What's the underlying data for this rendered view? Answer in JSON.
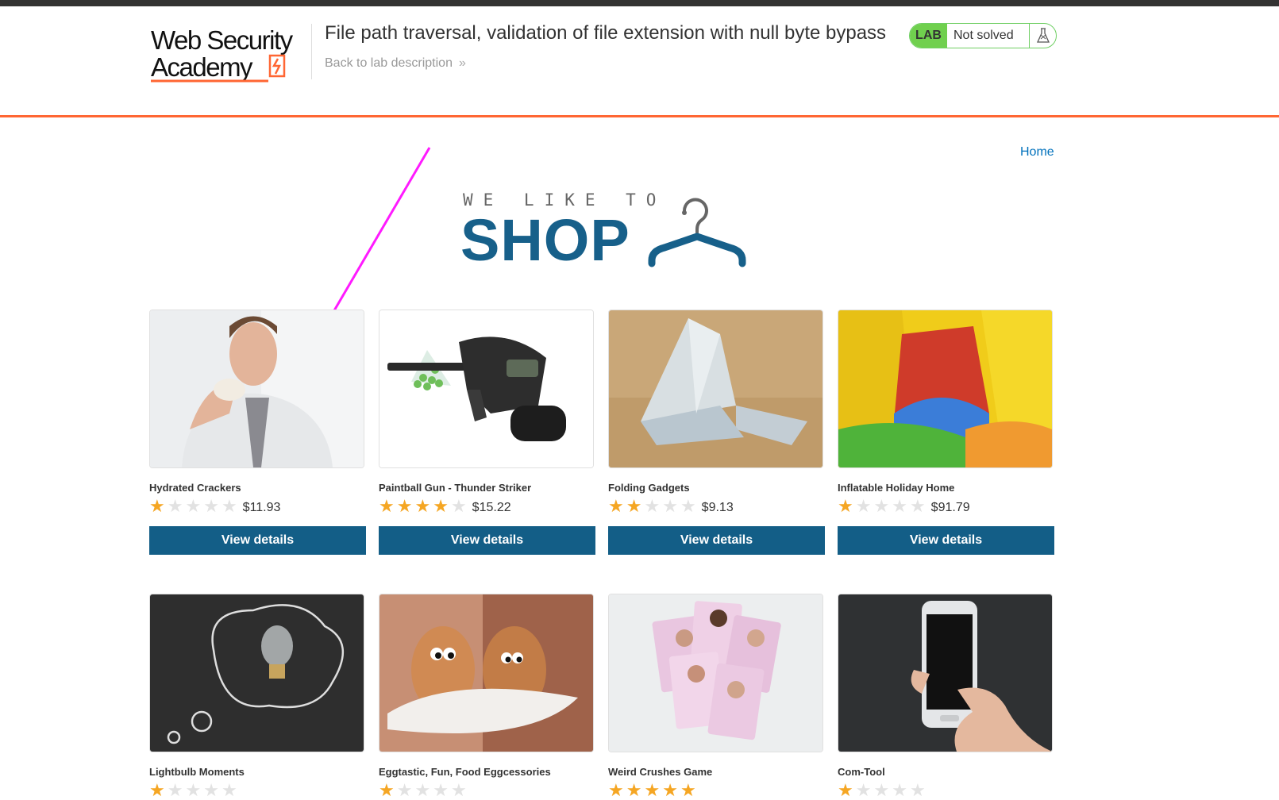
{
  "header": {
    "logo_line1": "Web Security",
    "logo_line2": "Academy",
    "lab_title": "File path traversal, validation of file extension with null byte bypass",
    "back_link": "Back to lab description",
    "lab_badge": "LAB",
    "lab_status": "Not solved",
    "accent_color": "#ff6633"
  },
  "nav": {
    "home": "Home"
  },
  "banner": {
    "small_text": "WE LIKE TO",
    "big_text": "SHOP",
    "color": "#17608a"
  },
  "products": [
    {
      "name": "Hydrated Crackers",
      "rating": 1,
      "price": "$11.93",
      "button": "View details"
    },
    {
      "name": "Paintball Gun - Thunder Striker",
      "rating": 4,
      "price": "$15.22",
      "button": "View details"
    },
    {
      "name": "Folding Gadgets",
      "rating": 2,
      "price": "$9.13",
      "button": "View details"
    },
    {
      "name": "Inflatable Holiday Home",
      "rating": 1,
      "price": "$91.79",
      "button": "View details"
    },
    {
      "name": "Lightbulb Moments",
      "rating": 1
    },
    {
      "name": "Eggtastic, Fun, Food Eggcessories",
      "rating": 1
    },
    {
      "name": "Weird Crushes Game",
      "rating": 5
    },
    {
      "name": "Com-Tool",
      "rating": 1
    }
  ]
}
